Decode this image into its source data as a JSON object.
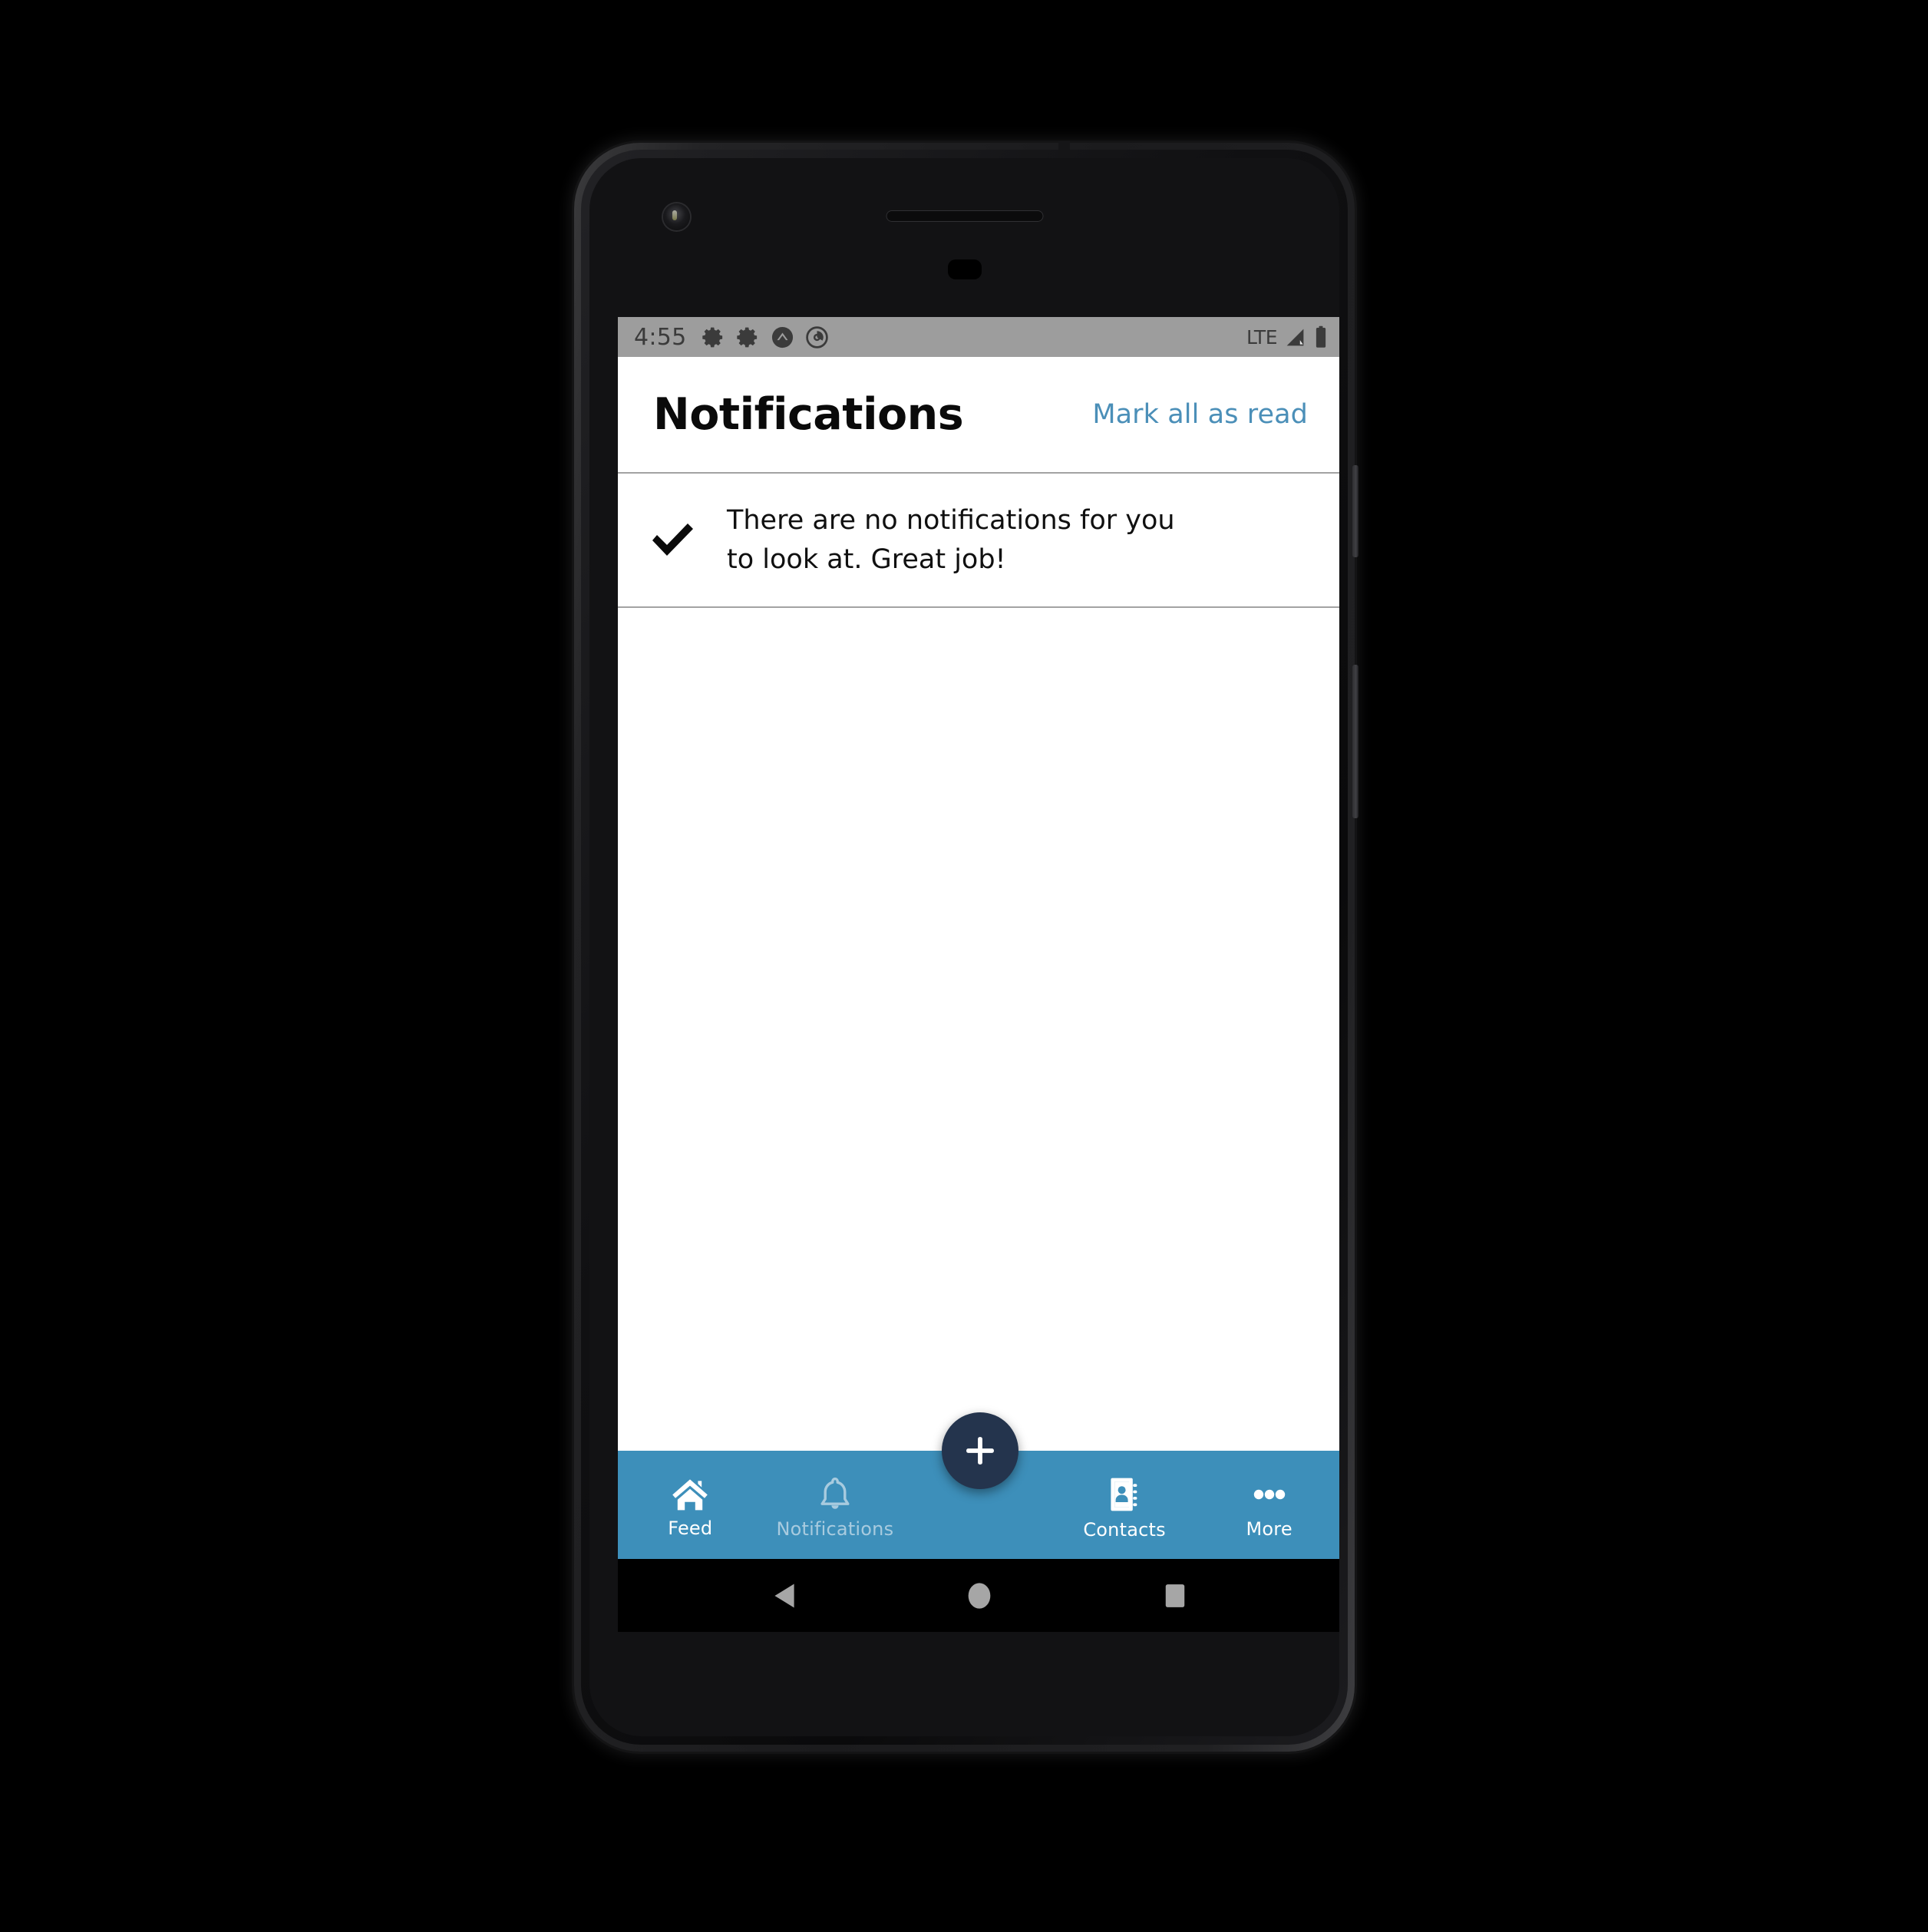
{
  "device": {
    "frame_color": "#1b1b1d",
    "camera_icon": "front-camera-icon",
    "speaker_icon": "earpiece-speaker-icon",
    "sensor_icon": "proximity-sensor-icon"
  },
  "status_bar": {
    "time": "4:55",
    "background": "#9d9d9d",
    "left_icons": [
      "gear-icon",
      "gear-icon",
      "chevron-up-circle-icon",
      "do-not-disturb-icon"
    ],
    "network_label": "LTE",
    "right_icons": [
      "signal-strength-icon",
      "battery-icon"
    ]
  },
  "header": {
    "title": "Notifications",
    "mark_all_label": "Mark all as read",
    "link_color": "#4b8fb8"
  },
  "empty_state": {
    "icon": "checkmark-icon",
    "message": "There are no notifications for you to look at. Great job!"
  },
  "fab": {
    "label": "+",
    "icon": "plus-icon",
    "color": "#24344d"
  },
  "bottom_nav": {
    "background": "#3d8fba",
    "active_color": "#ffffff",
    "inactive_color": "#a8cbdf",
    "tabs": [
      {
        "label": "Feed",
        "icon": "home-icon",
        "state": "active"
      },
      {
        "label": "Notifications",
        "icon": "bell-icon",
        "state": "dimmed"
      },
      {
        "label": "Contacts",
        "icon": "contact-book-icon",
        "state": "active"
      },
      {
        "label": "More",
        "icon": "ellipsis-icon",
        "state": "active"
      }
    ]
  },
  "android_nav": {
    "background": "#000000",
    "buttons": [
      {
        "name": "back",
        "icon": "triangle-back-icon"
      },
      {
        "name": "home",
        "icon": "circle-home-icon"
      },
      {
        "name": "recents",
        "icon": "square-recents-icon"
      }
    ]
  }
}
